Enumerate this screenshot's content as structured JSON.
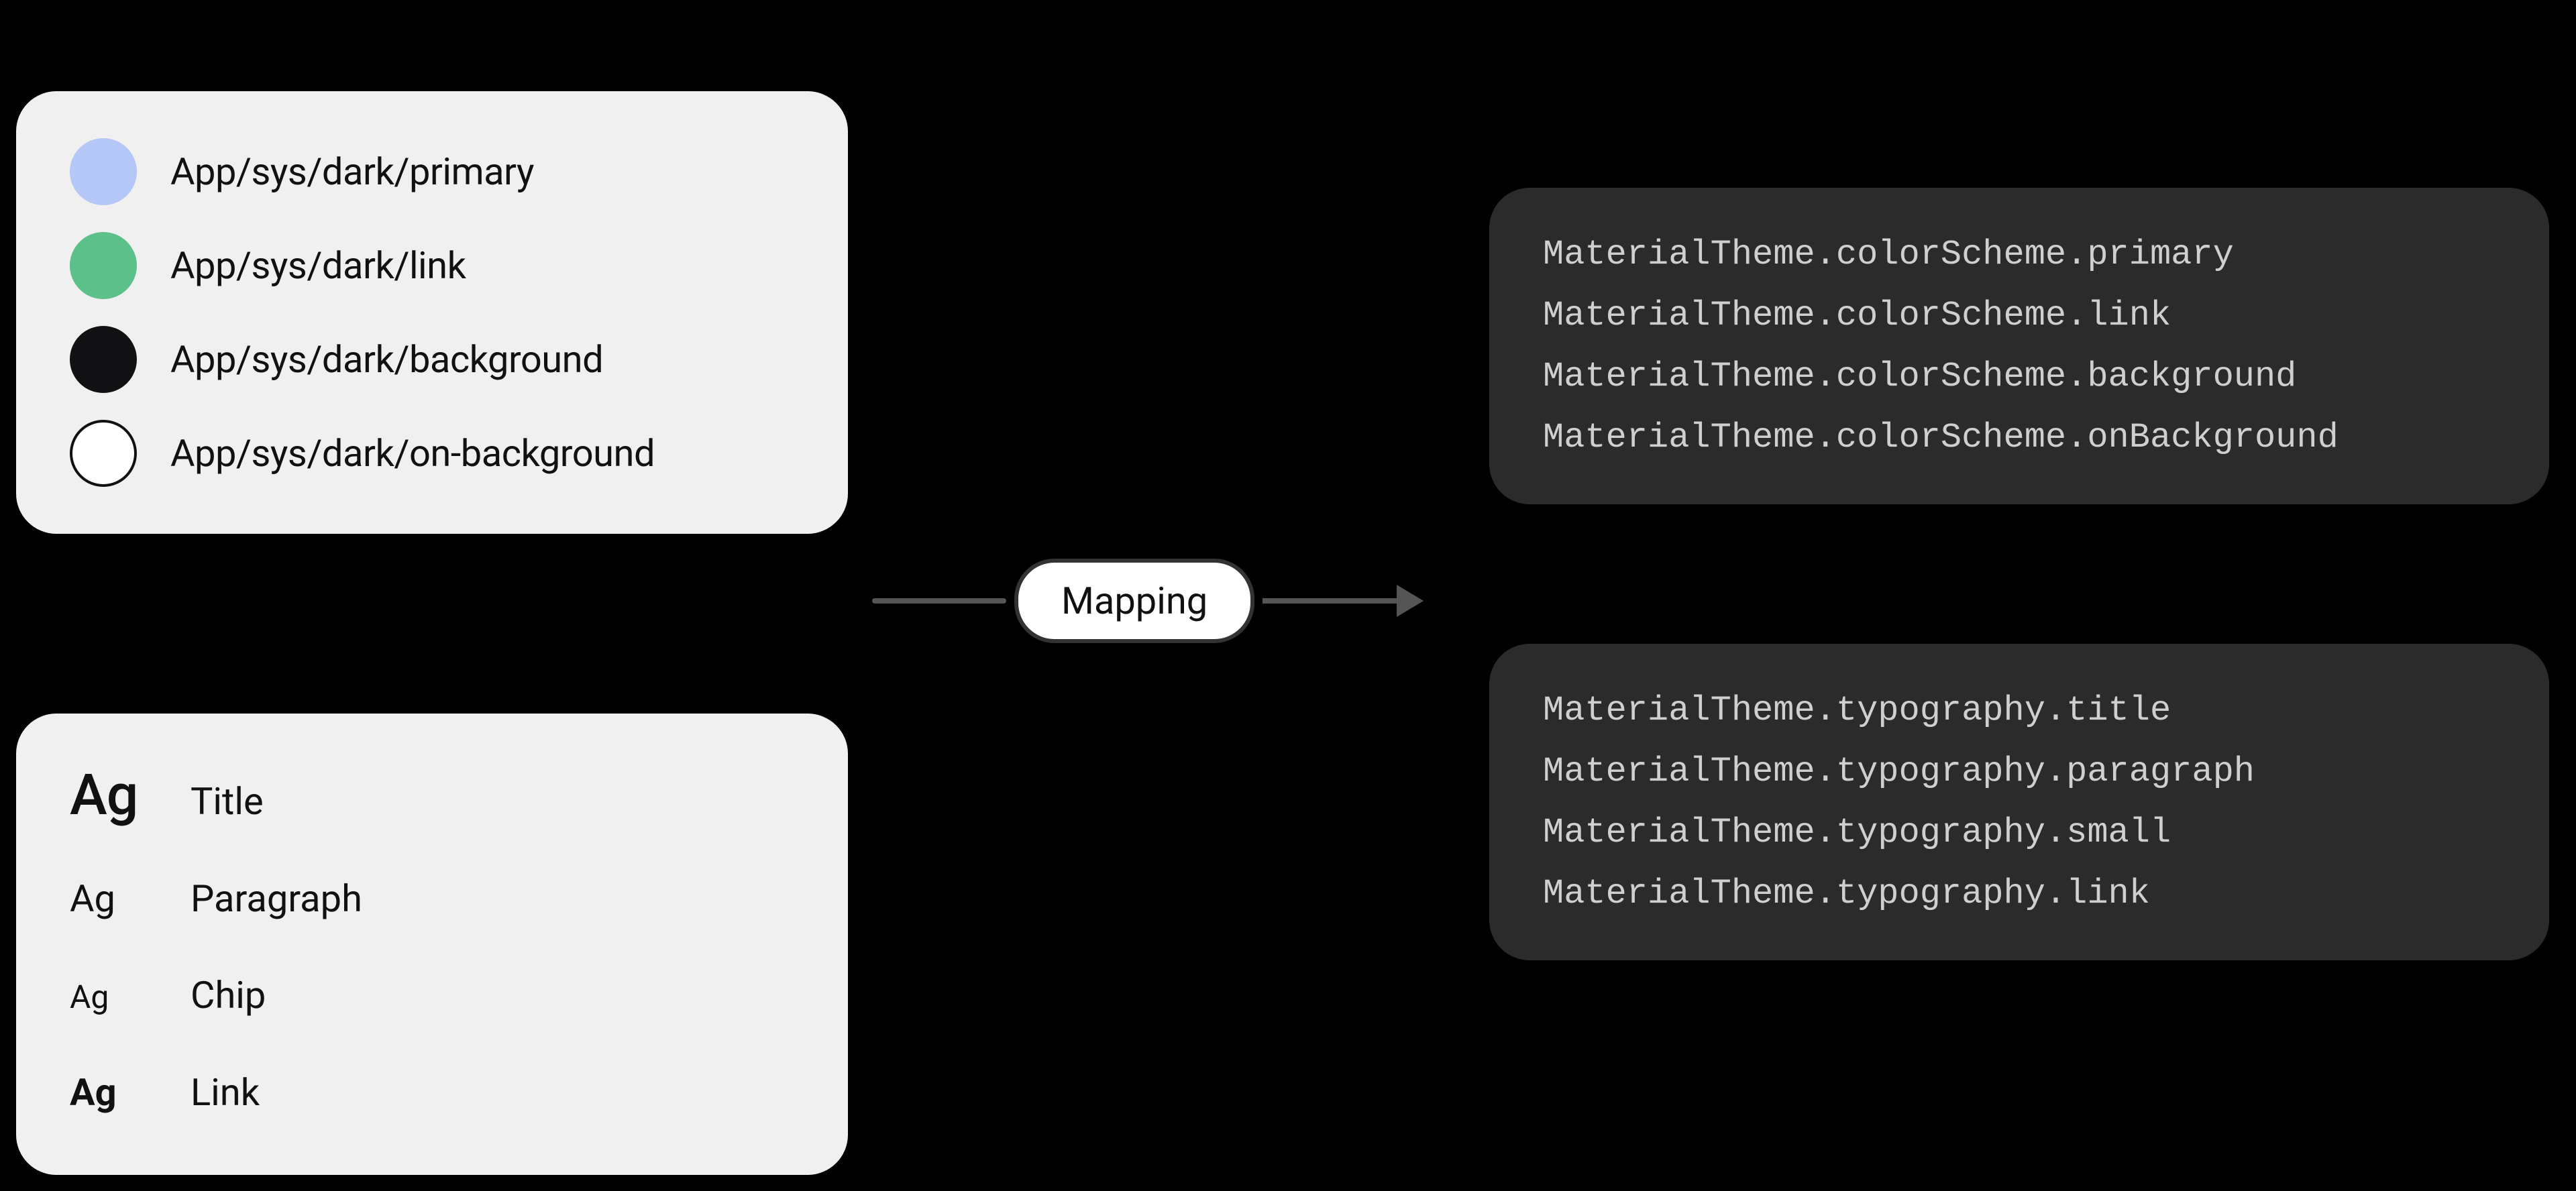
{
  "colors": {
    "items": [
      {
        "label": "App/sys/dark/primary",
        "hex": "#b4c7f6",
        "border": false
      },
      {
        "label": "App/sys/dark/link",
        "hex": "#5cc08a",
        "border": false
      },
      {
        "label": "App/sys/dark/background",
        "hex": "#111113",
        "border": false
      },
      {
        "label": "App/sys/dark/on-background",
        "hex": "#ffffff",
        "border": true
      }
    ]
  },
  "typography": {
    "sample": "Ag",
    "items": [
      {
        "label": "Title",
        "cls": "ag-title"
      },
      {
        "label": "Paragraph",
        "cls": "ag-para"
      },
      {
        "label": "Chip",
        "cls": "ag-chip"
      },
      {
        "label": "Link",
        "cls": "ag-link"
      }
    ]
  },
  "mapping": {
    "label": "Mapping"
  },
  "code": {
    "colors": [
      "MaterialTheme.colorScheme.primary",
      "MaterialTheme.colorScheme.link",
      "MaterialTheme.colorScheme.background",
      "MaterialTheme.colorScheme.onBackground"
    ],
    "typography": [
      "MaterialTheme.typography.title",
      "MaterialTheme.typography.paragraph",
      "MaterialTheme.typography.small",
      "MaterialTheme.typography.link"
    ]
  }
}
